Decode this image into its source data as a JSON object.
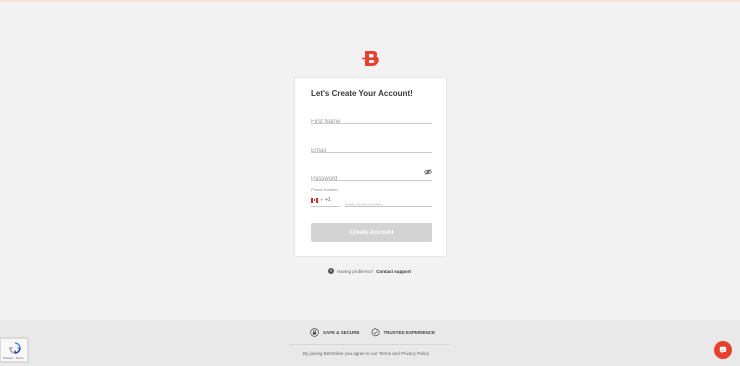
{
  "brand": {
    "accent": "#e8402f"
  },
  "form": {
    "title": "Let's Create Your Account!",
    "first_name_placeholder": "First Name",
    "email_placeholder": "Email",
    "password_placeholder": "Password",
    "phone_label": "Phone Number",
    "country_code": "+1",
    "phone_placeholder": "555-555-5555",
    "submit_label": "Create Account"
  },
  "help": {
    "text": "Having problems?",
    "link": "Contact support"
  },
  "footer": {
    "badges": [
      {
        "label": "SAFE & SECURE",
        "icon": "shield-lock-icon"
      },
      {
        "label": "TRUSTED EXPERIENCE",
        "icon": "check-badge-icon"
      }
    ],
    "text": "By joining BetOnline you agree to our Terms and Privacy Policy"
  },
  "recaptcha": {
    "text": "Privacy - Terms"
  },
  "icons": [
    "logo-b-icon",
    "eye-off-icon",
    "canada-flag-icon",
    "chevron-down-icon",
    "help-icon",
    "chat-icon",
    "recaptcha-icon"
  ]
}
